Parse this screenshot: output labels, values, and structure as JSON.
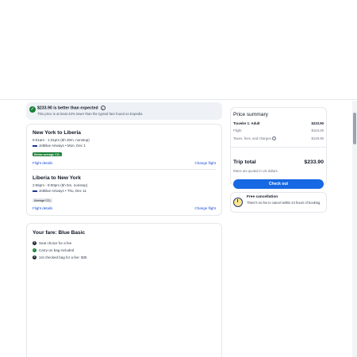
{
  "banner": {
    "title": "$233.90 is better than expected",
    "info_icon": "info-icon",
    "subtitle": "This price is at least 43% lower than the typical fare found on Expedia"
  },
  "flights": [
    {
      "route": "New York to Liberia",
      "times": "9:01am - 1:31pm (5h 30m, nonstop)",
      "airline": "JetBlue Airways • Mon, Dec 1",
      "badge": "Below average CO₂",
      "badge_style": "green",
      "details_link": "Flight details",
      "change_link": "Change flight"
    },
    {
      "route": "Liberia to New York",
      "times": "2:55pm - 9:00pm (5h 5m, nonstop)",
      "airline": "JetBlue Airways • Thu, Dec 11",
      "badge": "Average CO₂",
      "badge_style": "grey",
      "details_link": "Flight details",
      "change_link": "Change flight"
    }
  ],
  "fare": {
    "title": "Your fare: Blue Basic",
    "items": [
      {
        "text": "Seat choice for a fee",
        "icon": "dollar-icon"
      },
      {
        "text": "Carry-on bag included",
        "icon": "check-icon"
      },
      {
        "text": "1st checked bag for a fee: $35",
        "icon": "dollar-icon"
      }
    ]
  },
  "price_summary": {
    "title": "Price summary",
    "traveler_label": "Traveler 1: Adult",
    "traveler_value": "$233.90",
    "flight_label": "Flight",
    "flight_value": "$104.00",
    "taxes_label": "Taxes, fees, and charges",
    "taxes_value": "$129.90",
    "total_label": "Trip total",
    "total_value": "$233.90",
    "note": "Rates are quoted in US dollars",
    "checkout": "Check out"
  },
  "cancellation": {
    "title": "Free cancellation",
    "subtitle": "There's no fee to cancel within 24 hours of booking."
  },
  "colors": {
    "accent": "#1668e3",
    "success": "#1a7f37",
    "link": "#1d4ed8"
  }
}
